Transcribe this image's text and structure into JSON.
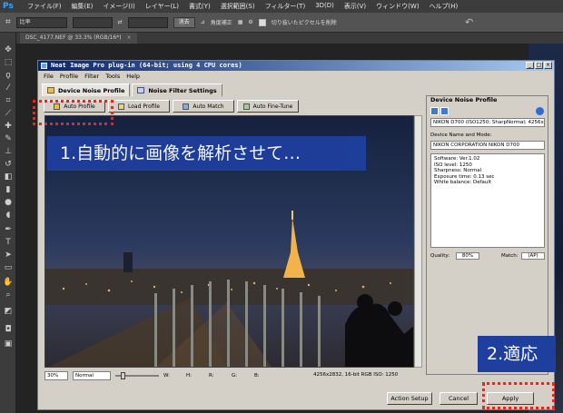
{
  "ps": {
    "logo": "Ps",
    "menu": [
      "ファイル(F)",
      "編集(E)",
      "イメージ(I)",
      "レイヤー(L)",
      "書式(Y)",
      "選択範囲(S)",
      "フィルター(T)",
      "3D(D)",
      "表示(V)",
      "ウィンドウ(W)",
      "ヘルプ(H)"
    ],
    "options": {
      "ratio_select": "比率",
      "clear_btn": "消去",
      "straighten_text": "角度補正",
      "delete_cropped_text": "切り抜いたピクセルを削除"
    },
    "doc_tab": "DSC_4177.NEF @ 33.3% (RGB/16*)"
  },
  "ni": {
    "title": "Neat Image Pro plug-in (64-bit; using 4 CPU cores)",
    "menu": [
      "File",
      "Profile",
      "Filter",
      "Tools",
      "Help"
    ],
    "tabs": [
      "Device Noise Profile",
      "Noise Filter Settings"
    ],
    "buttons": [
      "Auto Profile",
      "Load Profile",
      "Auto Match",
      "Auto Fine-Tune"
    ],
    "status": {
      "zoom": "30%",
      "mode": "Normal",
      "w": "W:",
      "h": "H:",
      "r": "R:",
      "g": "G:",
      "b": "B:",
      "info": "4256x2832, 16-bit RGB  ISO: 1250"
    },
    "panel": {
      "title": "Device Noise Profile",
      "profile_select": "NIKON D700 (ISO1250; SharpNormal; 4256x2832)",
      "device_label": "Device Name and Mode:",
      "device_model": "NIKON CORPORATION NIKON D700",
      "info_lines": [
        "Software: Ver.1.02",
        "ISO level: 1250",
        "Sharpness: Normal",
        "Exposure time: 0.13 sec",
        "White balance: Default"
      ],
      "quality_label": "Quality:",
      "quality_value": "80%",
      "match_label": "Match:",
      "match_value": "(AP)"
    },
    "bottom": {
      "action_setup": "Action Setup",
      "cancel": "Cancel",
      "apply": "Apply"
    }
  },
  "annotations": {
    "step1": "1.自動的に画像を解析させて…",
    "step2": "2.適応"
  },
  "colors": {
    "annotation_bg": "#1e3f9e",
    "annotation_dash": "#e8281d",
    "ps_accent": "#31a8ff"
  }
}
